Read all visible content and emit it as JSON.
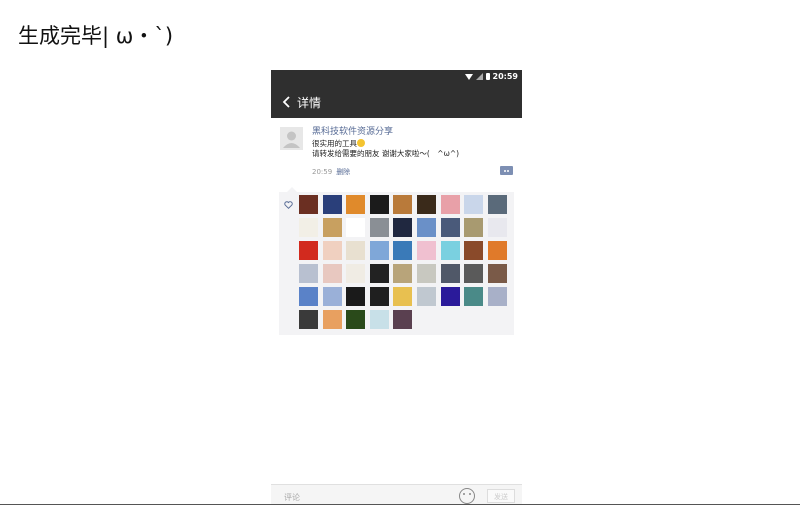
{
  "page_title": "生成完毕| ω・`)",
  "status_bar": {
    "time": "20:59",
    "icons": [
      "wifi-icon",
      "signal-icon",
      "battery-icon"
    ]
  },
  "nav": {
    "title": "详情",
    "back_icon": "chevron-left-icon"
  },
  "post": {
    "author": "黑科技软件资源分享",
    "text_line1": "很实用的工具",
    "text_line2": "请转发给需要的朋友 谢谢大家啦～(　^ω^)",
    "time": "20:59",
    "delete_label": "删除",
    "comment_icon": "comment-dots-icon"
  },
  "likes": {
    "heart_icon": "heart-outline-icon",
    "avatar_colors": [
      "#6b2f22",
      "#2a3f7a",
      "#e08a2b",
      "#1b1b1b",
      "#b97a3a",
      "#3a2a1a",
      "#e8a0a8",
      "#c9d6ea",
      "#5a6a7a",
      "#f2efe6",
      "#c8a060",
      "#ffffff",
      "#8a8f95",
      "#202840",
      "#6a90c8",
      "#4a5a7a",
      "#a89a70",
      "#e8e8ee",
      "#d22a1e",
      "#f0d0c0",
      "#e8e0d0",
      "#7fa7d8",
      "#3a7ab8",
      "#f0c0d0",
      "#7ad0e0",
      "#8a4a2a",
      "#e07a2a",
      "#b8c0d0",
      "#e8c8c0",
      "#f0ece4",
      "#222222",
      "#b8a47a",
      "#c8c8c0",
      "#505868",
      "#5a5a5a",
      "#7a5a48",
      "#5a82c8",
      "#9ab0d8",
      "#1a1a1a",
      "#1f1f1f",
      "#e8c050",
      "#c0c8d0",
      "#2a1a9a",
      "#4a8a88",
      "#a8b0c8",
      "#3a3a3a",
      "#e8a060",
      "#2a4a1a",
      "#c8e0e8",
      "#5a4050"
    ]
  },
  "bottom_bar": {
    "placeholder": "评论",
    "send_label": "发送",
    "emoji_icon": "emoji-face-icon"
  }
}
